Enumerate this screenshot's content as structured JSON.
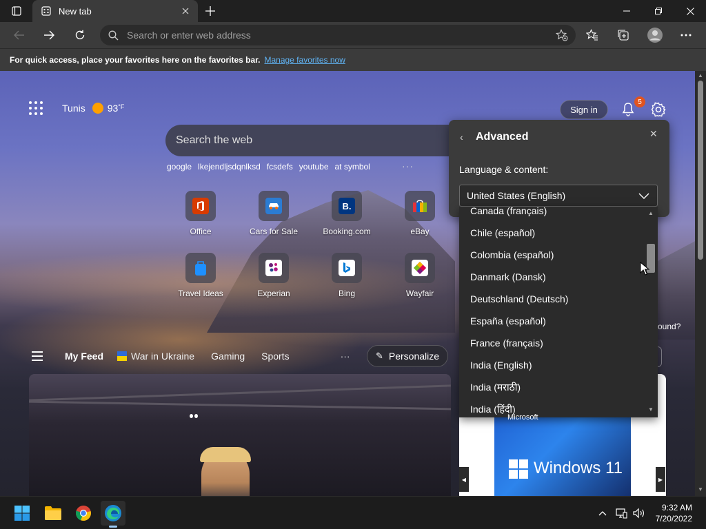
{
  "browser": {
    "tab_title": "New tab",
    "address_placeholder": "Search or enter web address",
    "favorites_bar": {
      "message": "For quick access, place your favorites here on the favorites bar.",
      "link": "Manage favorites now"
    }
  },
  "newtab": {
    "weather": {
      "city": "Tunis",
      "temp": "93",
      "unit": "°F"
    },
    "sign_in": "Sign in",
    "notification_count": "5",
    "search_placeholder": "Search the web",
    "quick_searches": [
      "google",
      "lkejendljsdqnlksd",
      "fcsdefs",
      "youtube",
      "at symbol"
    ],
    "quick_more": "···",
    "tiles": [
      {
        "label": "Office",
        "icon": "office-icon",
        "color": "#d83b01"
      },
      {
        "label": "Cars for Sale",
        "icon": "car-icon",
        "color": "#2b7cd3"
      },
      {
        "label": "Booking.com",
        "icon": "booking-icon",
        "color": "#003580"
      },
      {
        "label": "eBay",
        "icon": "ebay-icon",
        "color": "#e53238"
      },
      {
        "label": "Travel Ideas",
        "icon": "travel-bag-icon",
        "color": "#1e90ff"
      },
      {
        "label": "Experian",
        "icon": "experian-icon",
        "color": "#6d2077"
      },
      {
        "label": "Bing",
        "icon": "bing-icon",
        "color": "#0078d4"
      },
      {
        "label": "Wayfair",
        "icon": "wayfair-icon",
        "color": "#7f187f"
      }
    ],
    "tile_letters": {
      "booking": "B."
    },
    "feed": {
      "my_feed": "My Feed",
      "items": [
        "War in Ukraine",
        "Gaming",
        "Sports"
      ],
      "more": "···",
      "personalize": "Personalize"
    },
    "background_question": "ound?",
    "ad": {
      "brand": "Microsoft",
      "product": "Windows 11"
    }
  },
  "settings_panel": {
    "title": "Advanced",
    "section": "Language & content:",
    "selected": "United States (English)",
    "options": [
      "Canada (français)",
      "Chile (español)",
      "Colombia (español)",
      "Danmark (Dansk)",
      "Deutschland (Deutsch)",
      "España (español)",
      "France (français)",
      "India (English)",
      "India (मराठी)",
      "India (हिंदी)"
    ]
  },
  "taskbar": {
    "time": "9:32 AM",
    "date": "7/20/2022"
  }
}
